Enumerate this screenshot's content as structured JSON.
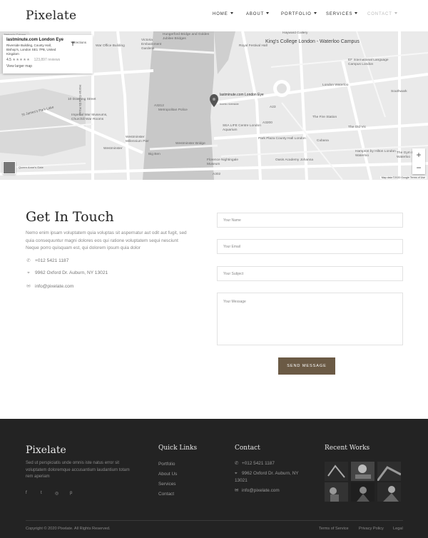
{
  "header": {
    "logo": "Pixelate",
    "nav": [
      {
        "label": "HOME"
      },
      {
        "label": "ABOUT"
      },
      {
        "label": "PORTFOLIO"
      },
      {
        "label": "SERVICES"
      },
      {
        "label": "CONTACT"
      }
    ]
  },
  "map": {
    "card": {
      "title": "lastminute.com London Eye",
      "address": "Riverside Building, County Hall, Bishop's, London SE1 7PB, United Kingdom",
      "rating": "4.5",
      "stars": "★★★★★",
      "reviews": "123,897 reviews",
      "larger_map": "View larger map",
      "directions": "Directions"
    },
    "labels": {
      "kings_college": "King's College London - Waterloo Campus",
      "pin": "lastminute.com London Eye",
      "pin_sub": "Iconic riverside",
      "aquarium": "SEA LIFE Centre London Aquarium",
      "metropolitan": "Metropolitan Police",
      "big_ben": "Big Ben",
      "westminster": "Westminster",
      "war_museums": "Imperial War Museums, Churchill War Rooms",
      "downing": "10 Downing Street",
      "st_james": "St James's Park Lake",
      "hayward": "Hayward Gallery",
      "festival": "Royal Festival Hall",
      "eu_london": "EF International Language Campus London",
      "southwark": "Southwark",
      "old_vic": "The Old Vic",
      "fire_station": "The Fire Station",
      "gym": "The Gym London Waterloo",
      "cubana": "Cubana",
      "park_plaza": "Park Plaza County Hall London",
      "florence": "Florence Nightingale Museum",
      "oasis": "Oasis Academy Johanna",
      "hampton": "Hampton by Hilton London Waterloo",
      "war_office": "War Office Building",
      "embankment": "Victoria Embankment Gardens",
      "south_bank": "Hungerford Bridge and Golden Jubilee Bridges",
      "queen_annes": "Queen Anne's Gate",
      "ldn_waterloo": "London Waterloo",
      "westminster_bridge": "Westminster Bridge",
      "horse_guards": "Horse Guards Road",
      "westminster_pier": "Westminster Millennium Pier",
      "nelson": "Nelson's Column",
      "a3200": "A3200",
      "a302": "A302",
      "a3212": "A3212",
      "a23": "A23"
    },
    "zoom_in": "+",
    "zoom_out": "−",
    "attribution": "Map data ©2020 Google   Terms of Use"
  },
  "contact": {
    "title": "Get In Touch",
    "text": "Nemo enim ipsam voluptatem quia voluptas sit aspernatur aut odit aut fugit, sed quia consequuntur magni dolores eos qui ratione voluptatem sequi nesciunt Neque porro quisquam est, qui dolorem ipsum quia dolor",
    "phone": "+012 5421 1187",
    "address": "9962 Oxford Dr. Auburn, NY 13021",
    "email": "info@pixelate.com",
    "form": {
      "name_placeholder": "Your Name",
      "email_placeholder": "Your Email",
      "subject_placeholder": "Your Subject",
      "message_placeholder": "Your Message",
      "send_label": "SEND MESSAGE"
    }
  },
  "footer": {
    "logo": "Pixelate",
    "about": "Sed ut perspiciatis unde omnis iste natus error sit voluptatem doloremque accusantium laudantium totam rem aperiam",
    "socials": [
      "f",
      "t",
      "◎",
      "p"
    ],
    "quick_links_title": "Quick Links",
    "quick_links": [
      "Portfolio",
      "About Us",
      "Services",
      "Contact"
    ],
    "contact_title": "Contact",
    "contact_phone": "+012 5421 1187",
    "contact_address": "9962 Oxford Dr. Auburn, NY 13021",
    "contact_email": "info@pixelate.com",
    "recent_works_title": "Recent Works",
    "copyright": "Copyright © 2020 Pixelate. All Rights Reserved.",
    "legal": [
      "Terms of Service",
      "Privacy Policy",
      "Legal"
    ]
  },
  "colors": {
    "accent": "#6b5a45",
    "footer_bg": "#232323"
  }
}
